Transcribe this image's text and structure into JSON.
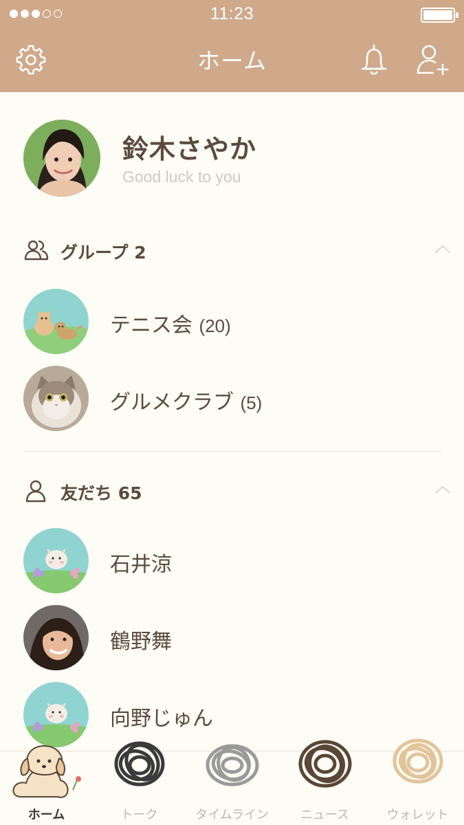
{
  "status_bar": {
    "time": "11:23",
    "signal_strength": 3,
    "signal_max": 5,
    "battery_level": 1.0
  },
  "nav": {
    "title": "ホーム",
    "icons": [
      "gear-icon",
      "bell-icon",
      "add-friend-icon"
    ]
  },
  "profile": {
    "name": "鈴木さやか",
    "status_message": "Good luck to you"
  },
  "groups_section": {
    "title": "グループ 2",
    "icon": "group-icon",
    "items": [
      {
        "name": "テニス会",
        "count": "(20)",
        "avatar": "dogs-in-grass"
      },
      {
        "name": "グルメクラブ",
        "count": "(5)",
        "avatar": "cat-photo"
      }
    ]
  },
  "friends_section": {
    "title": "友だち 65",
    "icon": "person-icon",
    "items": [
      {
        "name": "石井涼",
        "avatar": "puppy-with-flowers"
      },
      {
        "name": "鶴野舞",
        "avatar": "woman-photo"
      },
      {
        "name": "向野じゅん",
        "avatar": "puppy-with-flowers"
      }
    ]
  },
  "tabbar": {
    "tabs": [
      {
        "label": "ホーム",
        "active": true,
        "icon": "dog-sticker-icon"
      },
      {
        "label": "トーク",
        "active": false,
        "icon": "scribble-icon",
        "color": "#3a3a3a"
      },
      {
        "label": "タイムライン",
        "active": false,
        "icon": "scribble-icon",
        "color": "#9a9a9a"
      },
      {
        "label": "ニュース",
        "active": false,
        "icon": "scribble-icon",
        "color": "#5a4636"
      },
      {
        "label": "ウォレット",
        "active": false,
        "icon": "scribble-icon",
        "color": "#e2c49a"
      }
    ]
  },
  "colors": {
    "header": "#cfa98a",
    "background": "#fdfcf5",
    "text": "#5b4a40"
  }
}
